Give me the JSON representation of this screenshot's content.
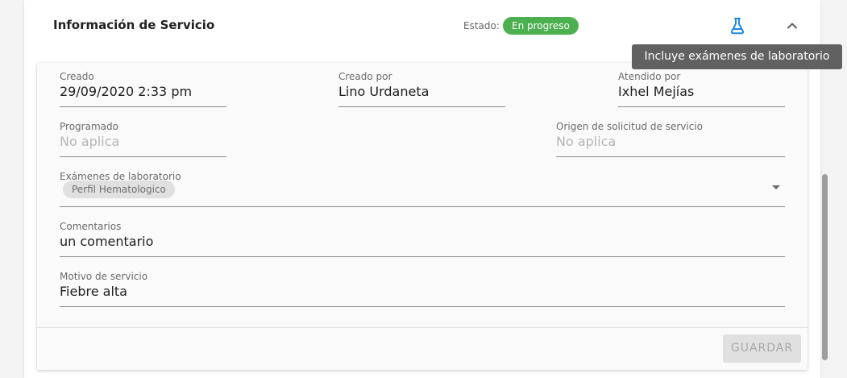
{
  "header": {
    "title": "Información de Servicio",
    "status_label": "Estado:",
    "status_value": "En progreso",
    "lab_icon": "flask-icon",
    "collapse_icon": "chevron-up-icon"
  },
  "tooltip": "Incluye exámenes de laboratorio",
  "fields": {
    "creado": {
      "label": "Creado",
      "value": "29/09/2020 2:33 pm"
    },
    "creado_por": {
      "label": "Creado por",
      "value": "Lino Urdaneta"
    },
    "atendido_por": {
      "label": "Atendido por",
      "value": "Ixhel Mejías"
    },
    "programado": {
      "label": "Programado",
      "value": "No aplica"
    },
    "origen": {
      "label": "Origen de solicitud de servicio",
      "value": "No aplica"
    },
    "examenes": {
      "label": "Exámenes de laboratorio",
      "chips": [
        "Perfil Hematologico"
      ]
    },
    "comentarios": {
      "label": "Comentarios",
      "value": "un comentario"
    },
    "motivo": {
      "label": "Motivo de servicio",
      "value": "Fiebre alta"
    }
  },
  "actions": {
    "save_label": "GUARDAR"
  },
  "colors": {
    "status_green": "#4caf50",
    "accent_blue": "#1e88e5",
    "tooltip_bg": "#616161"
  }
}
